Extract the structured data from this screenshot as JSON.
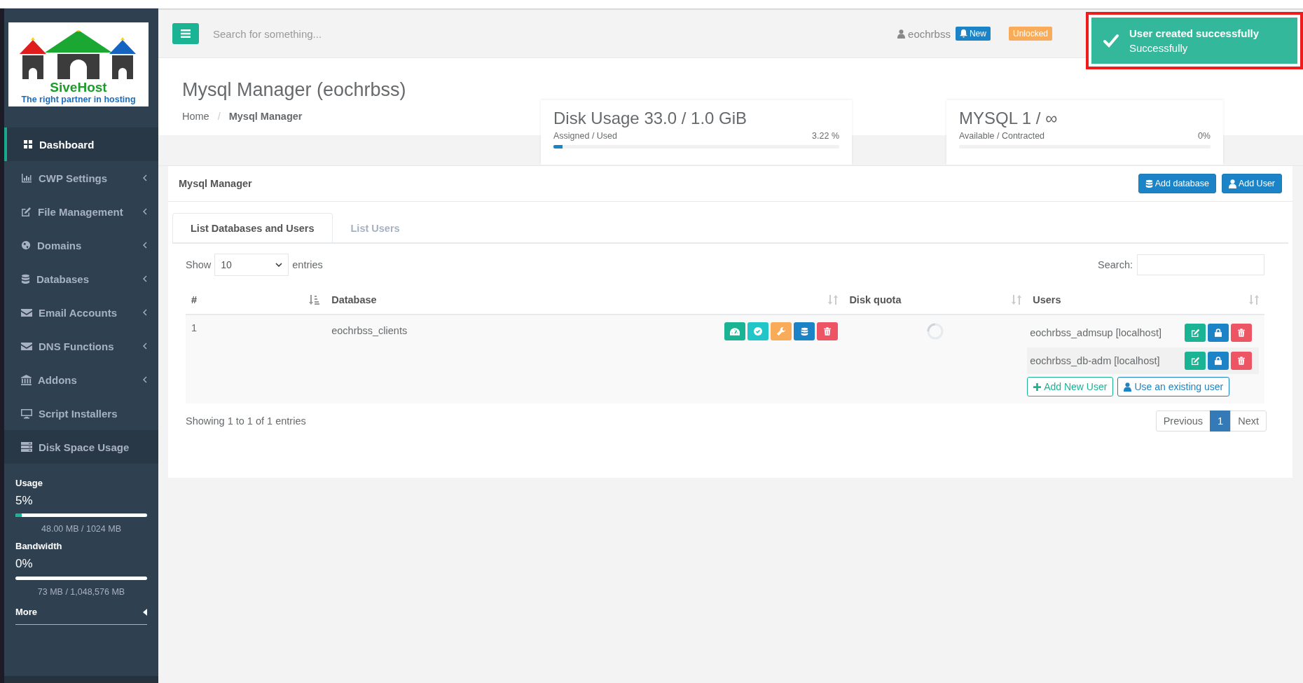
{
  "sidebar": {
    "logo": {
      "name": "SiveHost",
      "tagline": "The right partner in hosting"
    },
    "items": [
      {
        "label": "Dashboard",
        "selected": true,
        "expandable": false
      },
      {
        "label": "CWP Settings",
        "selected": false,
        "expandable": true
      },
      {
        "label": "File Management",
        "selected": false,
        "expandable": true
      },
      {
        "label": "Domains",
        "selected": false,
        "expandable": true
      },
      {
        "label": "Databases",
        "selected": false,
        "expandable": true
      },
      {
        "label": "Email Accounts",
        "selected": false,
        "expandable": true
      },
      {
        "label": "DNS Functions",
        "selected": false,
        "expandable": true
      },
      {
        "label": "Addons",
        "selected": false,
        "expandable": true
      },
      {
        "label": "Script Installers",
        "selected": false,
        "expandable": false
      },
      {
        "label": "Disk Space Usage",
        "selected": false,
        "expandable": false
      }
    ],
    "meters": [
      {
        "label": "Usage",
        "percent": "5%",
        "level": 0.05,
        "detail": "48.00 MB / 1024 MB"
      },
      {
        "label": "Bandwidth",
        "percent": "0%",
        "level": 0,
        "detail": "73 MB / 1,048,576 MB"
      }
    ],
    "more": "More"
  },
  "topbar": {
    "search": {
      "placeholder": "Search for something..."
    },
    "user": "eochrbss",
    "badges": [
      {
        "label": "New",
        "kind": "info"
      },
      {
        "label": "Unlocked",
        "kind": "warning"
      }
    ]
  },
  "toast": {
    "title": "User created successfully",
    "message": "Successfully"
  },
  "page": {
    "title": "Mysql Manager (eochrbss)",
    "separator": "/",
    "breadcrumb": [
      {
        "label": "Home",
        "selected": false
      },
      {
        "label": "Mysql Manager",
        "selected": true
      }
    ]
  },
  "stats": [
    {
      "title": "Disk Usage 33.0 / 1.0 GiB",
      "caption": "Assigned / Used",
      "reading": "3.22 %",
      "level": 0.0322
    },
    {
      "title": "MYSQL 1 / ∞",
      "caption": "Available / Contracted",
      "reading": "0%",
      "level": 0
    }
  ],
  "panel": {
    "title": "Mysql Manager",
    "actions": [
      "Add database",
      "Add User"
    ],
    "tabs": [
      {
        "label": "List Databases and Users",
        "selected": true
      },
      {
        "label": "List Users",
        "selected": false
      }
    ],
    "length": {
      "before": "Show",
      "value": "10",
      "after": "entries"
    },
    "search_label": "Search:",
    "columns": [
      {
        "label": "#",
        "sorted": true
      },
      {
        "label": "Database",
        "sorted": false
      },
      {
        "label": "Disk quota",
        "sorted": false
      },
      {
        "label": "Users",
        "sorted": false
      }
    ],
    "rows": [
      {
        "index": "1",
        "database": "eochrbss_clients",
        "users": [
          "eochrbss_admsup [localhost]",
          "eochrbss_db-adm [localhost]"
        ],
        "user_actions": [
          "Add New User",
          "Use an existing user"
        ]
      }
    ],
    "info": "Showing 1 to 1 of 1 entries",
    "pagination": [
      {
        "label": "Previous",
        "selected": false
      },
      {
        "label": "1",
        "selected": true
      },
      {
        "label": "Next",
        "selected": false
      }
    ]
  }
}
